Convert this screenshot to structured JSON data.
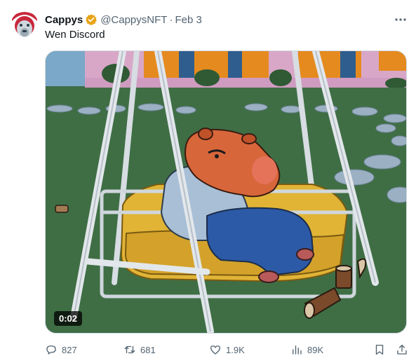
{
  "tweet": {
    "display_name": "Cappys",
    "handle": "@CappysNFT",
    "separator": "·",
    "date": "Feb 3",
    "text": "Wen Discord",
    "media": {
      "video_time": "0:02"
    },
    "actions": {
      "replies": "827",
      "reposts": "681",
      "likes": "1.9K",
      "views": "89K"
    }
  },
  "colors": {
    "verified_badge": "#e8a317",
    "secondary_text": "#536471",
    "primary_text": "#0f1419"
  },
  "icons": {
    "more": "more-dots-icon",
    "verified": "verified-badge-icon",
    "reply": "reply-icon",
    "repost": "repost-icon",
    "like": "heart-icon",
    "views": "views-icon",
    "bookmark": "bookmark-icon",
    "share": "share-icon"
  }
}
